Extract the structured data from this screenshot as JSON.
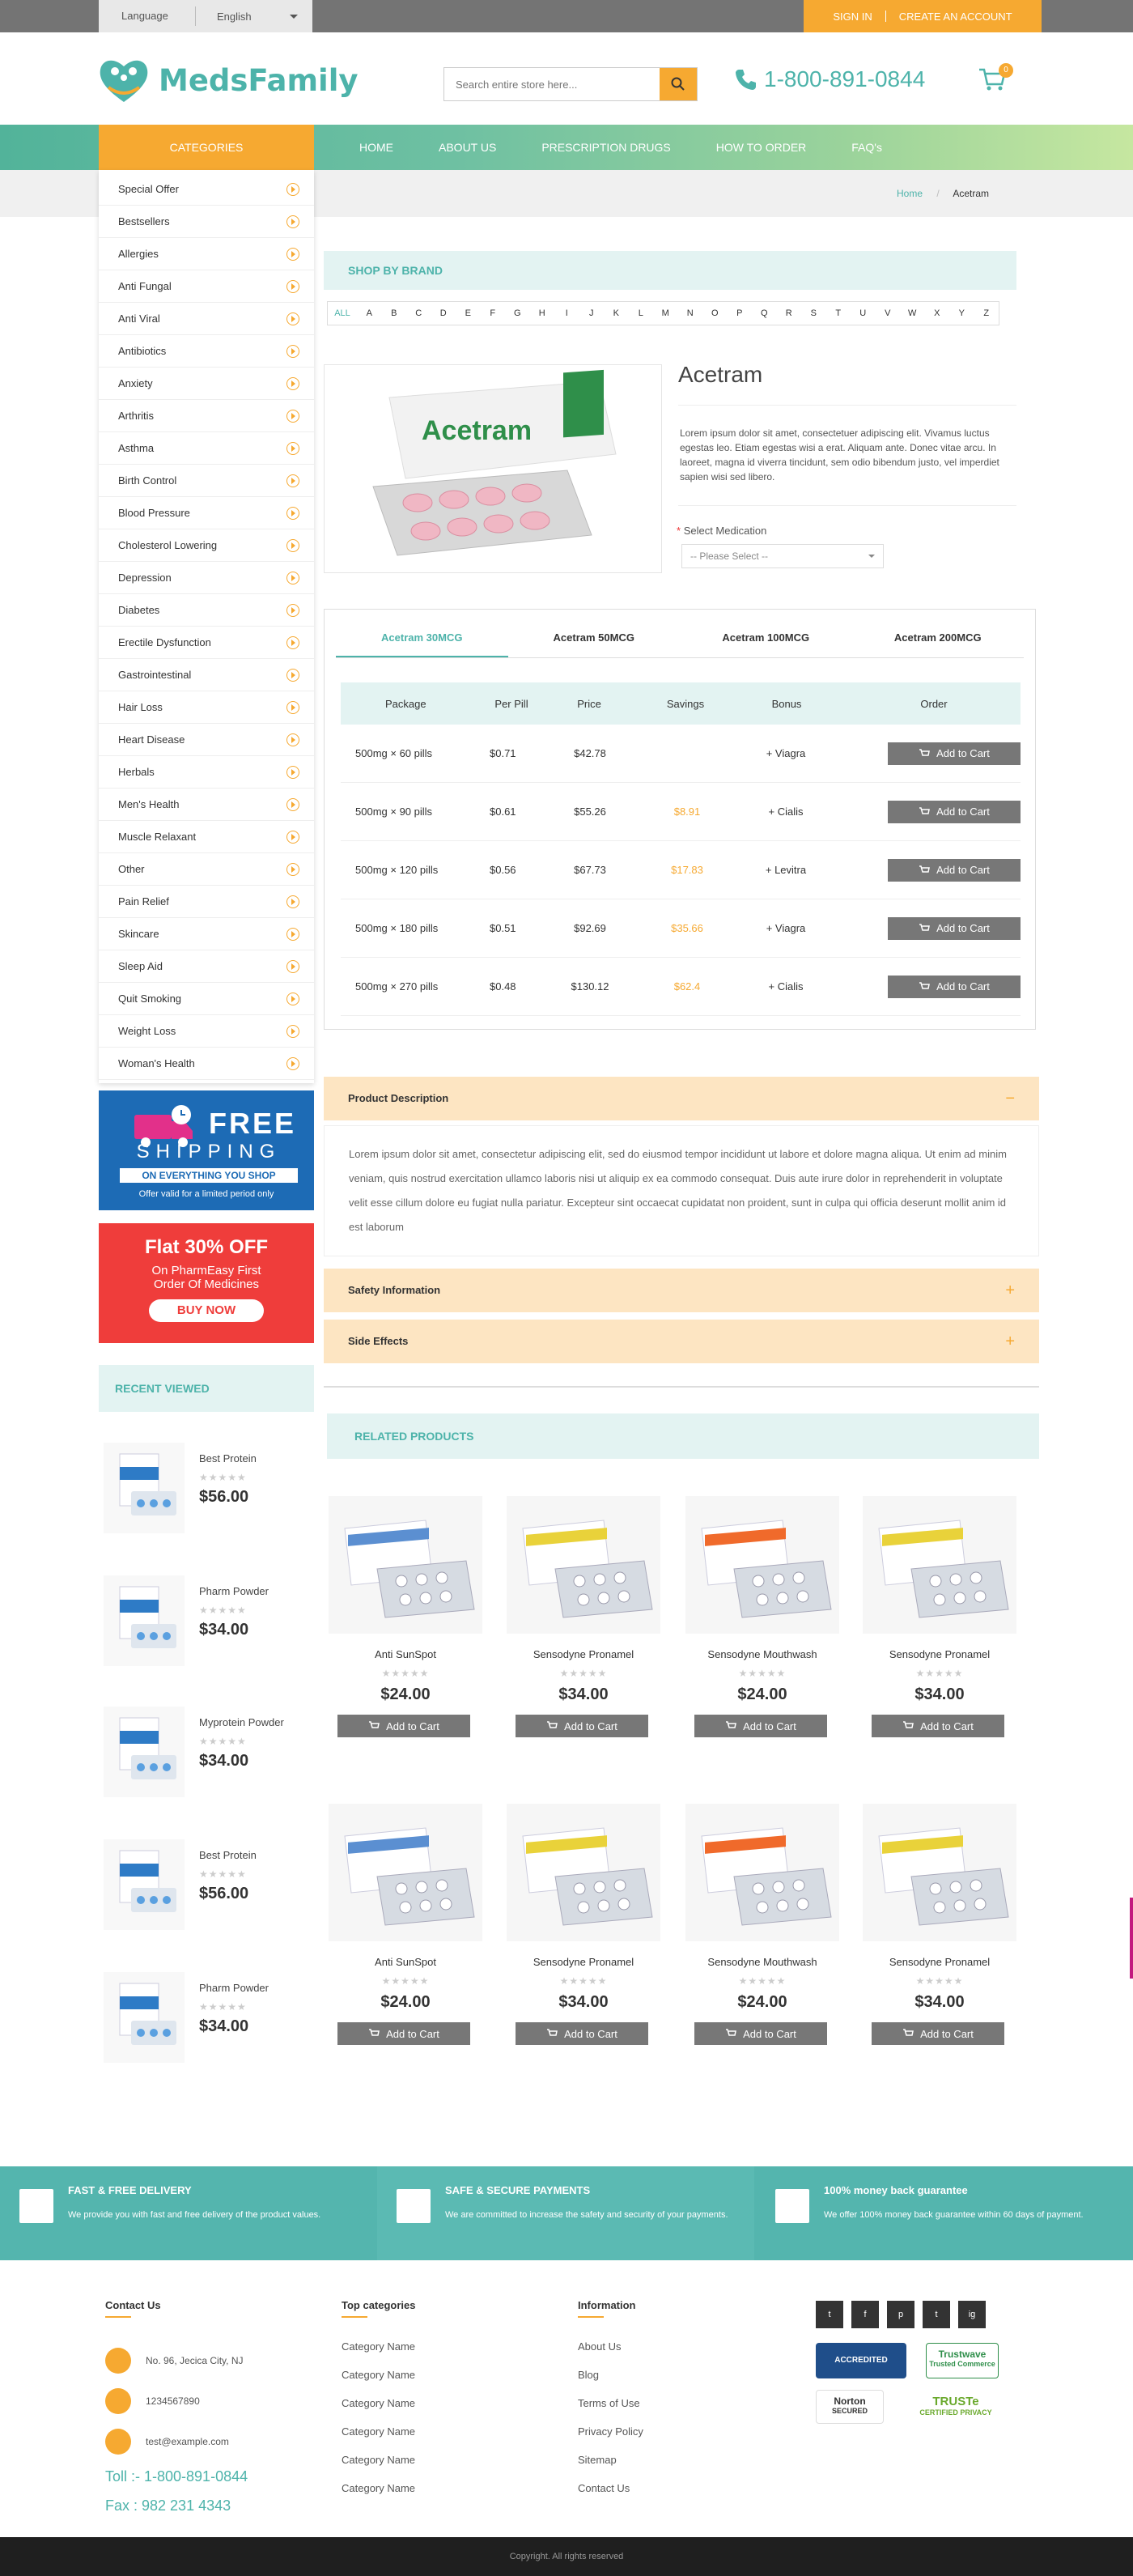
{
  "topbar": {
    "language_label": "Language",
    "language_value": "English",
    "signin": "SIGN IN",
    "create": "CREATE AN ACCOUNT"
  },
  "header": {
    "logo": "MedsFamily",
    "search_placeholder": "Search entire store here...",
    "phone": "1-800-891-0844",
    "cart_count": "0"
  },
  "nav": {
    "categories": "CATEGORIES",
    "items": [
      "HOME",
      "ABOUT US",
      "PRESCRIPTION DRUGS",
      "HOW TO ORDER",
      "FAQ's"
    ]
  },
  "breadcrumb": {
    "home": "Home",
    "sep": "/",
    "current": "Acetram"
  },
  "categories": [
    "Special Offer",
    "Bestsellers",
    "Allergies",
    "Anti Fungal",
    "Anti Viral",
    "Antibiotics",
    "Anxiety",
    "Arthritis",
    "Asthma",
    "Birth Control",
    "Blood Pressure",
    "Cholesterol Lowering",
    "Depression",
    "Diabetes",
    "Erectile Dysfunction",
    "Gastrointestinal",
    "Hair Loss",
    "Heart Disease",
    "Herbals",
    "Men's Health",
    "Muscle Relaxant",
    "Other",
    "Pain Relief",
    "Skincare",
    "Sleep Aid",
    "Quit Smoking",
    "Weight Loss",
    "Woman's Health"
  ],
  "banner_shipping": {
    "big": "FREE",
    "sub": "SHIPPING",
    "strip": "ON EVERYTHING YOU SHOP",
    "small": "Offer valid for a limited period only"
  },
  "banner_offer": {
    "title": "Flat 30% OFF",
    "line1": "On PharmEasy First",
    "line2": "Order Of Medicines",
    "button": "BUY NOW"
  },
  "recent": {
    "title": "RECENT VIEWED",
    "items": [
      {
        "name": "Best Protein",
        "price": "$56.00"
      },
      {
        "name": "Pharm Powder",
        "price": "$34.00"
      },
      {
        "name": "Myprotein Powder",
        "price": "$34.00"
      },
      {
        "name": "Best Protein",
        "price": "$56.00"
      },
      {
        "name": "Pharm Powder",
        "price": "$34.00"
      }
    ]
  },
  "brand": {
    "title": "SHOP BY BRAND",
    "letters": [
      "ALL",
      "A",
      "B",
      "C",
      "D",
      "E",
      "F",
      "G",
      "H",
      "I",
      "J",
      "K",
      "L",
      "M",
      "N",
      "O",
      "P",
      "Q",
      "R",
      "S",
      "T",
      "U",
      "V",
      "W",
      "X",
      "Y",
      "Z"
    ]
  },
  "product": {
    "name": "Acetram",
    "box_label": "Acetram",
    "description": "Lorem ipsum dolor sit amet, consectetuer adipiscing elit. Vivamus luctus egestas leo. Etiam egestas wisi a erat. Aliquam ante. Donec vitae arcu. In laoreet, magna id viverra tincidunt, sem odio bibendum justo, vel imperdiet sapien wisi sed libero.",
    "select_label": "Select Medication",
    "select_required": "*",
    "select_value": "-- Please Select --"
  },
  "tabs": [
    "Acetram 30MCG",
    "Acetram 50MCG",
    "Acetram 100MCG",
    "Acetram 200MCG"
  ],
  "table": {
    "headers": [
      "Package",
      "Per Pill",
      "Price",
      "Savings",
      "Bonus",
      "Order"
    ],
    "rows": [
      {
        "package": "500mg × 60 pills",
        "per_pill": "$0.71",
        "price": "$42.78",
        "savings": "",
        "bonus": "+ Viagra",
        "order": "Add to Cart"
      },
      {
        "package": "500mg × 90 pills",
        "per_pill": "$0.61",
        "price": "$55.26",
        "savings": "$8.91",
        "bonus": "+ Cialis",
        "order": "Add to Cart"
      },
      {
        "package": "500mg × 120 pills",
        "per_pill": "$0.56",
        "price": "$67.73",
        "savings": "$17.83",
        "bonus": "+ Levitra",
        "order": "Add to Cart"
      },
      {
        "package": "500mg × 180 pills",
        "per_pill": "$0.51",
        "price": "$92.69",
        "savings": "$35.66",
        "bonus": "+ Viagra",
        "order": "Add to Cart"
      },
      {
        "package": "500mg × 270 pills",
        "per_pill": "$0.48",
        "price": "$130.12",
        "savings": "$62.4",
        "bonus": "+ Cialis",
        "order": "Add to Cart"
      }
    ]
  },
  "accordion": {
    "desc_title": "Product Description",
    "desc_sign": "−",
    "desc_body": "Lorem ipsum dolor sit amet, consectetur adipiscing elit, sed do eiusmod tempor incididunt ut labore et dolore magna aliqua. Ut enim ad minim veniam, quis nostrud exercitation ullamco laboris nisi ut aliquip ex ea commodo consequat. Duis aute irure dolor in reprehenderit in voluptate velit esse cillum dolore eu fugiat nulla pariatur. Excepteur sint occaecat cupidatat non proident, sunt in culpa qui officia deserunt mollit anim id est laborum",
    "safety": "Safety Information",
    "side": "Side Effects",
    "plus": "+"
  },
  "related": {
    "title": "RELATED PRODUCTS",
    "items": [
      {
        "name": "Anti SunSpot",
        "price": "$24.00"
      },
      {
        "name": "Sensodyne Pronamel",
        "price": "$34.00"
      },
      {
        "name": "Sensodyne Mouthwash",
        "price": "$24.00"
      },
      {
        "name": "Sensodyne Pronamel",
        "price": "$34.00"
      },
      {
        "name": "Anti SunSpot",
        "price": "$24.00"
      },
      {
        "name": "Sensodyne Pronamel",
        "price": "$34.00"
      },
      {
        "name": "Sensodyne Mouthwash",
        "price": "$24.00"
      },
      {
        "name": "Sensodyne Pronamel",
        "price": "$34.00"
      }
    ],
    "button": "Add to Cart"
  },
  "stars": "★★★★★",
  "features": [
    {
      "title": "FAST & FREE DELIVERY",
      "desc": "We provide you with fast and free delivery of the product values."
    },
    {
      "title": "SAFE & SECURE PAYMENTS",
      "desc": "We are committed to increase the safety and security of your payments."
    },
    {
      "title": "100% money back guarantee",
      "desc": "We offer 100% money back guarantee within 60 days of payment."
    }
  ],
  "footer": {
    "contact_title": "Contact Us",
    "address": "No. 96, Jecica City, NJ",
    "phone": "1234567890",
    "email": "test@example.com",
    "toll": "Toll :- 1-800-891-0844",
    "fax": "Fax : 982 231 4343",
    "cat_title": "Top categories",
    "cats": [
      "Category Name",
      "Category Name",
      "Category Name",
      "Category Name",
      "Category Name",
      "Category Name"
    ],
    "info_title": "Information",
    "info": [
      "About Us",
      "Blog",
      "Terms of Use",
      "Privacy Policy",
      "Sitemap",
      "Contact Us"
    ],
    "social": [
      "t",
      "f",
      "p",
      "t",
      "ig"
    ],
    "trust": {
      "bbb": "ACCREDITED BUSINESS",
      "trustwave": "Trustwave",
      "trustwave_sub": "Trusted Commerce",
      "norton": "Norton",
      "norton_sub": "SECURED",
      "truste": "TRUSTe",
      "truste_sub": "CERTIFIED PRIVACY"
    },
    "copyright": "Copyright. All rights reserved"
  },
  "colors": {
    "teal": "#4db3aa",
    "orange": "#f6a931",
    "grey_btn": "#777777"
  }
}
